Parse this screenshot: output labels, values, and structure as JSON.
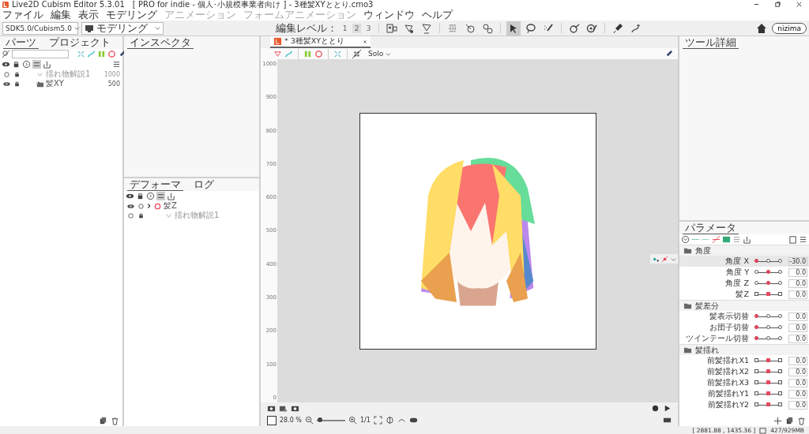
{
  "window": {
    "title": "Live2D Cubism Editor 5.3.01　[ PRO for indie - 個人･小規模事業者向け ] - 3種髪XYととり.cmo3"
  },
  "menu": [
    {
      "label": "ファイル",
      "disabled": false
    },
    {
      "label": "編集",
      "disabled": false
    },
    {
      "label": "表示",
      "disabled": false
    },
    {
      "label": "モデリング",
      "disabled": false
    },
    {
      "label": "アニメーション",
      "disabled": true
    },
    {
      "label": "フォームアニメーション",
      "disabled": true
    },
    {
      "label": "ウィンドウ",
      "disabled": false
    },
    {
      "label": "ヘルプ",
      "disabled": false
    }
  ],
  "toolbar": {
    "sdk_select": "SDK5.0/Cubism5.0",
    "mode_select": "モデリング",
    "edit_level_label": "編集レベル：",
    "edit_levels": [
      {
        "label": "1",
        "selected": false
      },
      {
        "label": "2",
        "selected": true
      },
      {
        "label": "3",
        "selected": false
      }
    ],
    "nizima_button": "nizima"
  },
  "parts_panel": {
    "tabs": [
      {
        "label": "パーツ",
        "selected": true
      },
      {
        "label": "プロジェクト",
        "selected": false
      }
    ],
    "rows": [
      {
        "name": "揺れ物解説1",
        "value": "1000",
        "visible": false,
        "folder": false
      },
      {
        "name": "髪XY",
        "value": "500",
        "visible": true,
        "folder": true
      }
    ]
  },
  "inspector_panel": {
    "tabs": [
      {
        "label": "インスペクタ",
        "selected": true
      }
    ]
  },
  "deformer_panel": {
    "tabs": [
      {
        "label": "デフォーマ",
        "selected": true
      },
      {
        "label": "ログ",
        "selected": false
      }
    ],
    "rows": [
      {
        "name": "髪Z",
        "visible": true,
        "children": [
          {
            "name": "揺れ物解説1",
            "visible": false
          }
        ]
      }
    ]
  },
  "canvas": {
    "tab": "* 3種髪XYととり",
    "solo": "Solo",
    "ruler": [
      "1000",
      "900",
      "800",
      "700",
      "600",
      "500",
      "400",
      "300",
      "200",
      "100",
      "0"
    ],
    "zoom": "28.0 %",
    "zoom_slider": {
      "level": 0.1
    },
    "page": "1/1"
  },
  "tool_details_panel": {
    "tabs": [
      {
        "label": "ツール詳細",
        "selected": true
      }
    ]
  },
  "parameter_panel": {
    "tabs": [
      {
        "label": "パラメータ",
        "selected": true
      }
    ],
    "groups": [
      {
        "name": "角度",
        "params": [
          {
            "name": "角度 X",
            "value": "-30.0",
            "level": 0,
            "kind": "circle",
            "selected": true
          },
          {
            "name": "角度 Y",
            "value": "0.0",
            "level": 0.5,
            "kind": "circle",
            "selected": false
          },
          {
            "name": "角度 Z",
            "value": "0.0",
            "level": 0.5,
            "kind": "circle",
            "selected": false
          },
          {
            "name": "髪Z",
            "value": "0.0",
            "level": 0.5,
            "kind": "square",
            "selected": false
          }
        ]
      },
      {
        "name": "髪差分",
        "params": [
          {
            "name": "髪表示切替",
            "value": "0.0",
            "level": 0,
            "kind": "circle",
            "selected": false
          },
          {
            "name": "お団子切替",
            "value": "0.0",
            "level": 0,
            "kind": "circle",
            "selected": false
          },
          {
            "name": "ツインテール切替",
            "value": "0.0",
            "level": 0,
            "kind": "circle",
            "selected": false
          }
        ]
      },
      {
        "name": "髪揺れ",
        "params": [
          {
            "name": "前髪揺れX1",
            "value": "0.0",
            "level": 0.5,
            "kind": "square",
            "selected": false
          },
          {
            "name": "前髪揺れX2",
            "value": "0.0",
            "level": 0.5,
            "kind": "square",
            "selected": false
          },
          {
            "name": "前髪揺れX3",
            "value": "0.0",
            "level": 0.5,
            "kind": "square",
            "selected": false
          },
          {
            "name": "前髪揺れY1",
            "value": "0.0",
            "level": 0.5,
            "kind": "square",
            "selected": false
          },
          {
            "name": "前髪揺れY2",
            "value": "0.0",
            "level": 0.5,
            "kind": "square",
            "selected": false
          }
        ]
      }
    ]
  },
  "status_bar": {
    "coordinates": "[ 2881.88 , 1435.36 ]",
    "memory": "427/929MB"
  }
}
